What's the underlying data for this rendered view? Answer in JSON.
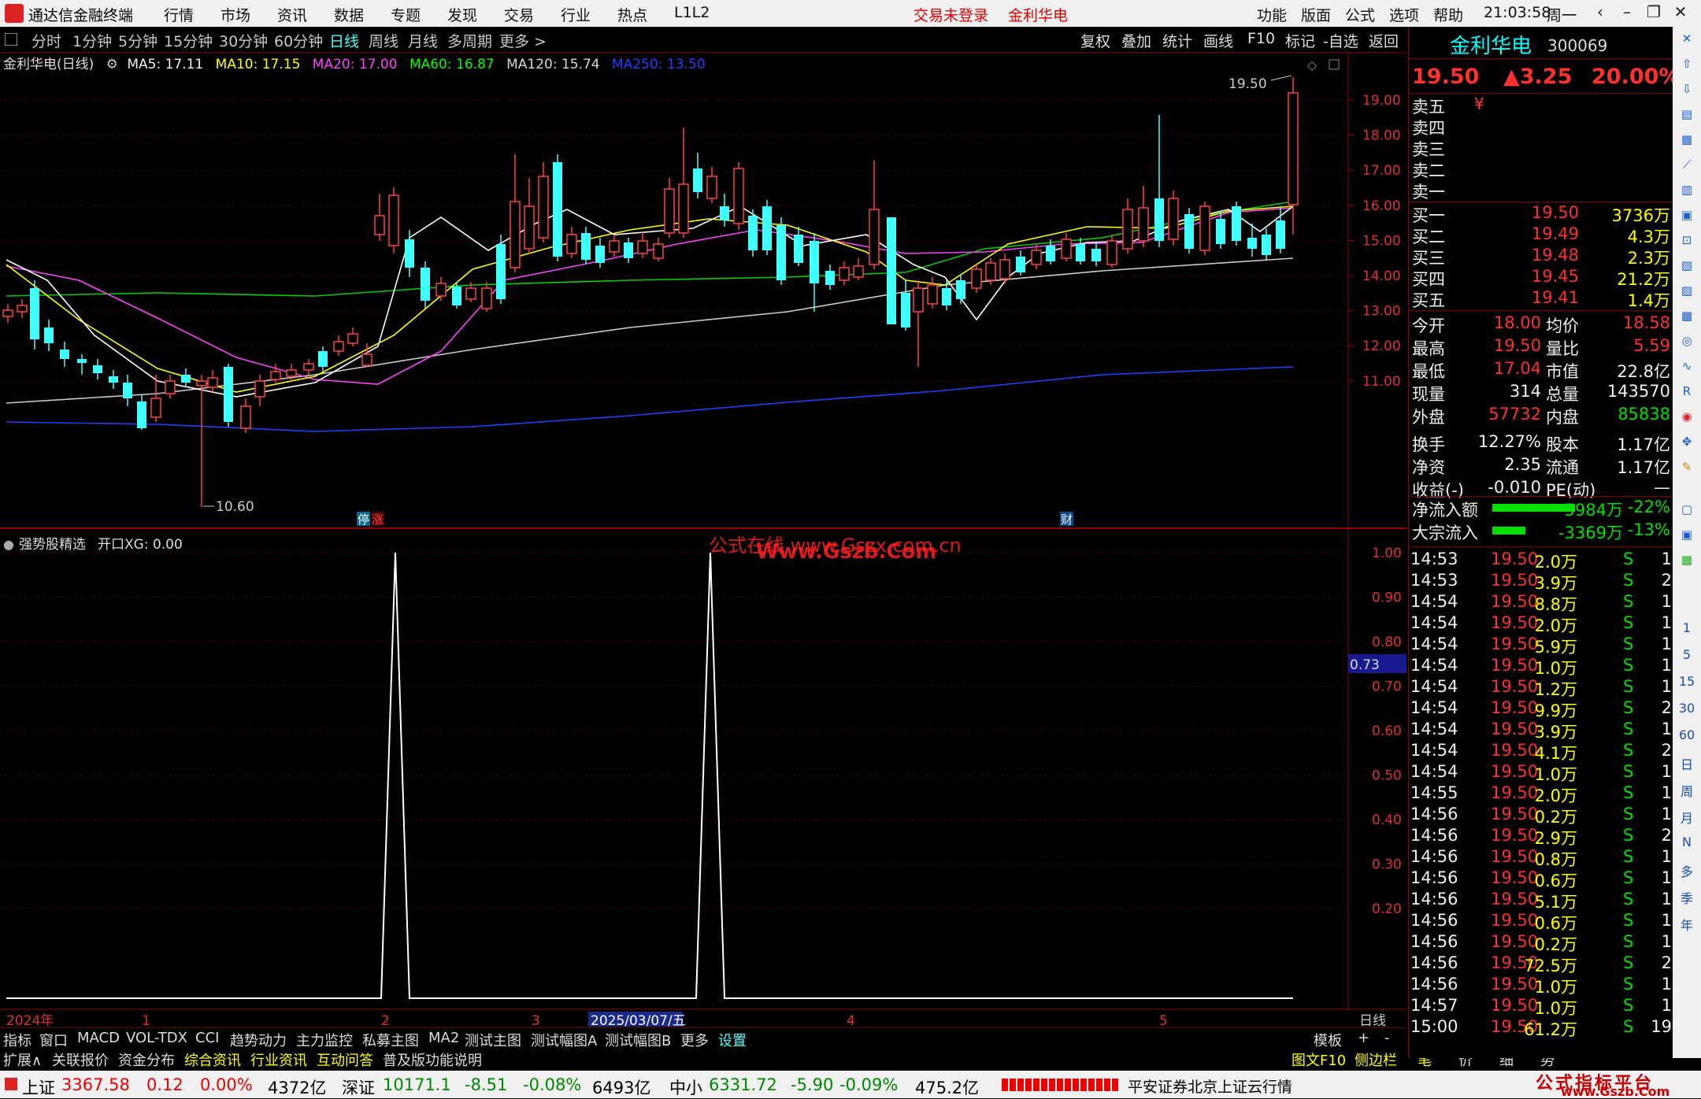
{
  "menubar": {
    "app_title": "通达信金融终端",
    "menus": [
      "行情",
      "市场",
      "资讯",
      "数据",
      "专题",
      "发现",
      "交易",
      "行业",
      "热点",
      "L1L2"
    ],
    "login_status": "交易未登录",
    "stock_name": "金利华电",
    "right_menus": [
      "功能",
      "版面",
      "公式",
      "选项",
      "帮助"
    ],
    "time": "21:03:58",
    "weekday": "周一"
  },
  "period_tabs": [
    "分时",
    "1分钟",
    "5分钟",
    "15分钟",
    "30分钟",
    "60分钟",
    "日线",
    "周线",
    "月线",
    "多周期",
    "更多 >"
  ],
  "active_tab": "日线",
  "right_tabs": [
    "复权",
    "叠加",
    "统计",
    "画线",
    "F10",
    "标记",
    "-自选",
    "返回"
  ],
  "chart_title": "金利华电(日线)",
  "ma_values": [
    {
      "label": "MA5: 17.11",
      "color": "#f0f0f0"
    },
    {
      "label": "MA10: 17.15",
      "color": "#ffff00"
    },
    {
      "label": "MA20: 17.00",
      "color": "#ff40ff"
    },
    {
      "label": "MA60: 16.87",
      "color": "#00ff00"
    },
    {
      "label": "MA120: 15.74",
      "color": "#d8d8d8"
    },
    {
      "label": "MA250: 13.50",
      "color": "#2040ff"
    }
  ],
  "price_axis": [
    "19.00",
    "18.00",
    "17.00",
    "16.00",
    "15.00",
    "14.00",
    "13.00",
    "12.00",
    "11.00"
  ],
  "high_marker": "19.50",
  "low_marker": "10.60",
  "event_tags": [
    "停",
    "涨",
    "财"
  ],
  "indicator_title": "强势股精选",
  "indicator_value": "开口XG: 0.00",
  "indicator_axis": [
    "1.00",
    "0.90",
    "0.80",
    "0.70",
    "0.60",
    "0.50",
    "0.40",
    "0.30",
    "0.20"
  ],
  "indicator_cursor": "0.73",
  "watermark1": "公式在线 www.Gszx.com.cn",
  "watermark2": "Www.Gszb.Com",
  "date_axis": [
    "2024年",
    "1",
    "2",
    "3",
    "2025/03/07/五",
    "4",
    "5"
  ],
  "date_axis_right": "日线",
  "tool_tabs": [
    "指标",
    "窗口",
    "MACD",
    "VOL-TDX",
    "CCI",
    "趋势动力",
    "主力监控",
    "私募主图",
    "MA2",
    "测试主图",
    "测试幅图A",
    "测试幅图B",
    "更多",
    "设置"
  ],
  "tool_tabs_right": [
    "模板",
    "+",
    "-"
  ],
  "bottom_tabs": [
    "扩展∧",
    "关联报价",
    "资金分布",
    "综合资讯",
    "行业资讯",
    "互动问答",
    "普及版功能说明"
  ],
  "bottom_right": [
    "图文F10",
    "侧边栏《",
    "笔",
    "价",
    "细",
    "势"
  ],
  "quote": {
    "name": "金利华电",
    "code": "300069",
    "price": "19.50",
    "change": "▲3.25",
    "pct": "20.00%",
    "sells": [
      {
        "label": "卖五",
        "price": "¥",
        "vol": ""
      },
      {
        "label": "卖四",
        "price": "",
        "vol": ""
      },
      {
        "label": "卖三",
        "price": "",
        "vol": ""
      },
      {
        "label": "卖二",
        "price": "",
        "vol": ""
      },
      {
        "label": "卖一",
        "price": "",
        "vol": ""
      }
    ],
    "buys": [
      {
        "label": "买一",
        "price": "19.50",
        "vol": "3736万"
      },
      {
        "label": "买二",
        "price": "19.49",
        "vol": "4.3万"
      },
      {
        "label": "买三",
        "price": "19.48",
        "vol": "2.3万"
      },
      {
        "label": "买四",
        "price": "19.45",
        "vol": "21.2万"
      },
      {
        "label": "买五",
        "price": "19.41",
        "vol": "1.4万"
      }
    ],
    "stats": [
      {
        "l1": "今开",
        "v1": "18.00",
        "c1": "red",
        "l2": "均价",
        "v2": "18.58",
        "c2": "red"
      },
      {
        "l1": "最高",
        "v1": "19.50",
        "c1": "red",
        "l2": "量比",
        "v2": "5.59",
        "c2": "red"
      },
      {
        "l1": "最低",
        "v1": "17.04",
        "c1": "red",
        "l2": "市值",
        "v2": "22.8亿",
        "c2": "white"
      },
      {
        "l1": "现量",
        "v1": "314",
        "c1": "white",
        "l2": "总量",
        "v2": "143570",
        "c2": "white"
      },
      {
        "l1": "外盘",
        "v1": "57732",
        "c1": "red",
        "l2": "内盘",
        "v2": "85838",
        "c2": "green"
      },
      {
        "l1": "换手",
        "v1": "12.27%",
        "c1": "white",
        "l2": "股本",
        "v2": "1.17亿",
        "c2": "white"
      },
      {
        "l1": "净资",
        "v1": "2.35",
        "c1": "white",
        "l2": "流通",
        "v2": "1.17亿",
        "c2": "white"
      },
      {
        "l1": "收益(-)",
        "v1": "-0.010",
        "c1": "white",
        "l2": "PE(动)",
        "v2": "—",
        "c2": "white"
      }
    ],
    "flows": [
      {
        "label": "净流入额",
        "value": "-5984万",
        "pct": "-22%",
        "bar": 0.55
      },
      {
        "label": "大宗流入",
        "value": "-3369万",
        "pct": "-13%",
        "bar": 0.22
      }
    ],
    "ticks": [
      {
        "t": "14:53",
        "p": "19.50",
        "v": "2.0万",
        "s": "S",
        "n": "1"
      },
      {
        "t": "14:53",
        "p": "19.50",
        "v": "3.9万",
        "s": "S",
        "n": "2"
      },
      {
        "t": "14:54",
        "p": "19.50",
        "v": "8.8万",
        "s": "S",
        "n": "1"
      },
      {
        "t": "14:54",
        "p": "19.50",
        "v": "2.0万",
        "s": "S",
        "n": "1"
      },
      {
        "t": "14:54",
        "p": "19.50",
        "v": "5.9万",
        "s": "S",
        "n": "1"
      },
      {
        "t": "14:54",
        "p": "19.50",
        "v": "1.0万",
        "s": "S",
        "n": "1"
      },
      {
        "t": "14:54",
        "p": "19.50",
        "v": "1.2万",
        "s": "S",
        "n": "1"
      },
      {
        "t": "14:54",
        "p": "19.50",
        "v": "9.9万",
        "s": "S",
        "n": "2"
      },
      {
        "t": "14:54",
        "p": "19.50",
        "v": "3.9万",
        "s": "S",
        "n": "1"
      },
      {
        "t": "14:54",
        "p": "19.50",
        "v": "4.1万",
        "s": "S",
        "n": "2"
      },
      {
        "t": "14:54",
        "p": "19.50",
        "v": "1.0万",
        "s": "S",
        "n": "1"
      },
      {
        "t": "14:55",
        "p": "19.50",
        "v": "2.0万",
        "s": "S",
        "n": "1"
      },
      {
        "t": "14:56",
        "p": "19.50",
        "v": "0.2万",
        "s": "S",
        "n": "1"
      },
      {
        "t": "14:56",
        "p": "19.50",
        "v": "2.9万",
        "s": "S",
        "n": "2"
      },
      {
        "t": "14:56",
        "p": "19.50",
        "v": "0.8万",
        "s": "S",
        "n": "1"
      },
      {
        "t": "14:56",
        "p": "19.50",
        "v": "0.6万",
        "s": "S",
        "n": "1"
      },
      {
        "t": "14:56",
        "p": "19.50",
        "v": "5.1万",
        "s": "S",
        "n": "1"
      },
      {
        "t": "14:56",
        "p": "19.50",
        "v": "0.6万",
        "s": "S",
        "n": "1"
      },
      {
        "t": "14:56",
        "p": "19.50",
        "v": "0.2万",
        "s": "S",
        "n": "1"
      },
      {
        "t": "14:56",
        "p": "19.50",
        "v": "72.5万",
        "s": "S",
        "n": "2"
      },
      {
        "t": "14:56",
        "p": "19.50",
        "v": "1.0万",
        "s": "S",
        "n": "1"
      },
      {
        "t": "14:57",
        "p": "19.50",
        "v": "1.0万",
        "s": "S",
        "n": "1"
      },
      {
        "t": "15:00",
        "p": "19.50",
        "v": "61.2万",
        "s": "S",
        "n": "19"
      }
    ]
  },
  "right_toolbar": [
    "1",
    "5",
    "15",
    "30",
    "60",
    "日",
    "周",
    "月",
    "N",
    "多",
    "季",
    "年"
  ],
  "status": {
    "sh_label": "上证",
    "sh_val": "3367.58",
    "sh_chg": "0.12",
    "sh_pct": "0.00%",
    "sh_amt": "4372亿",
    "sz_label": "深证",
    "sz_val": "10171.1",
    "sz_chg": "-8.51",
    "sz_pct": "-0.08%",
    "sz_amt": "6493亿",
    "zx_label": "中小",
    "zx_val": "6331.72",
    "zx_chg": "-5.90",
    "zx_pct": "-0.09%",
    "zx_amt": "475.2亿",
    "server": "平安证券北京上证云行情",
    "brand": "公式指标平台",
    "brand_url": "www.Gszb.Com"
  }
}
